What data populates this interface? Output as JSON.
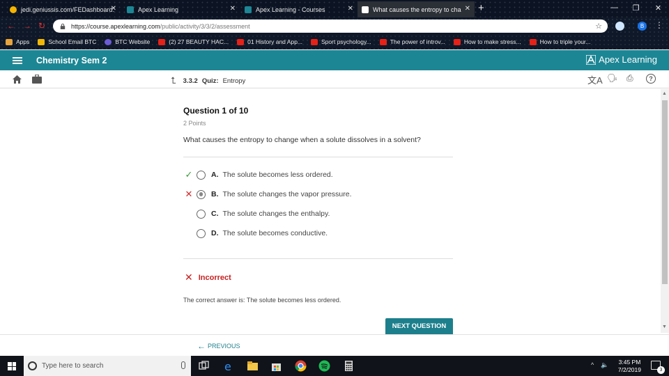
{
  "browser": {
    "tabs": [
      {
        "title": "jedi.geniussis.com/FEDashboard.",
        "color": "#f5b400"
      },
      {
        "title": "Apex Learning",
        "color": "#1d8694"
      },
      {
        "title": "Apex Learning - Courses",
        "color": "#1d8694"
      },
      {
        "title": "What causes the entropy to cha",
        "color": "#222222",
        "active": true
      }
    ],
    "new_tab": "+",
    "url_host": "https://course.apexlearning.com",
    "url_path": "/public/activity/3/3/2/assessment",
    "profile_initial": "B",
    "bookmarks": [
      {
        "label": "Apps",
        "icon": "apps-grid-icon",
        "color": "#e8a33c"
      },
      {
        "label": "School Email BTC",
        "icon": "school-email-icon",
        "color": "#f2b705"
      },
      {
        "label": "BTC Website",
        "icon": "btc-website-icon",
        "color": "#6c5bd6"
      },
      {
        "label": "(2) 27 BEAUTY HAC...",
        "icon": "youtube-icon",
        "color": "#e62117"
      },
      {
        "label": "01 History and App...",
        "icon": "youtube-icon",
        "color": "#e62117"
      },
      {
        "label": "Sport psychology...",
        "icon": "youtube-icon",
        "color": "#e62117"
      },
      {
        "label": "The power of introv...",
        "icon": "youtube-icon",
        "color": "#e62117"
      },
      {
        "label": "How to make stress...",
        "icon": "youtube-icon",
        "color": "#e62117"
      },
      {
        "label": "How to triple your...",
        "icon": "youtube-icon",
        "color": "#e62117"
      }
    ]
  },
  "header": {
    "course_title": "Chemistry Sem 2",
    "brand": "Apex Learning",
    "accent_color": "#1d8694"
  },
  "toolbar": {
    "activity_number": "3.3.2",
    "activity_type": "Quiz:",
    "activity_name": "Entropy"
  },
  "question": {
    "title": "Question 1 of 10",
    "points": "2 Points",
    "text": "What causes the entropy to change when a solute dissolves in a solvent?",
    "options": [
      {
        "letter": "A.",
        "text": "The solute becomes less ordered.",
        "mark": "✓",
        "mark_color": "#3c9a3c",
        "selected": false
      },
      {
        "letter": "B.",
        "text": "The solute changes the vapor pressure.",
        "mark": "✕",
        "mark_color": "#d22b2b",
        "selected": true
      },
      {
        "letter": "C.",
        "text": "The solute changes the enthalpy.",
        "mark": "",
        "mark_color": "",
        "selected": false
      },
      {
        "letter": "D.",
        "text": "The solute becomes conductive.",
        "mark": "",
        "mark_color": "",
        "selected": false
      }
    ]
  },
  "feedback": {
    "status": "Incorrect",
    "status_color": "#c62020",
    "correct_answer_line": "The correct answer is: The solute becomes less ordered."
  },
  "actions": {
    "next_label": "NEXT QUESTION",
    "previous_label": "PREVIOUS"
  },
  "taskbar": {
    "search_placeholder": "Type here to search",
    "time": "3:45 PM",
    "date": "7/2/2019",
    "notification_count": "3"
  }
}
